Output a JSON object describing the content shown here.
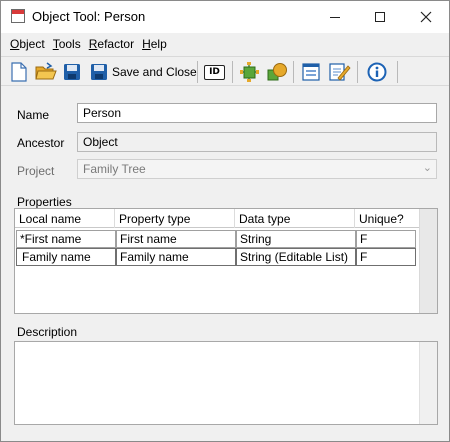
{
  "window": {
    "title": "Object Tool: Person"
  },
  "menu": {
    "items": [
      {
        "accel": "O",
        "rest": "bject"
      },
      {
        "accel": "T",
        "rest": "ools"
      },
      {
        "accel": "R",
        "rest": "efactor"
      },
      {
        "accel": "H",
        "rest": "elp"
      }
    ]
  },
  "toolbar": {
    "save_close_label": "Save and Close",
    "id_label": "ID"
  },
  "form": {
    "name_label": "Name",
    "name_value": "Person",
    "ancestor_label": "Ancestor",
    "ancestor_value": "Object",
    "project_label": "Project",
    "project_value": "Family Tree"
  },
  "properties": {
    "section_label": "Properties",
    "columns": [
      "Local name",
      "Property type",
      "Data type",
      "Unique?"
    ],
    "rows": [
      [
        "*First name",
        "First name",
        "String",
        "F"
      ],
      [
        "Family name",
        "Family name",
        "String (Editable List)",
        "F"
      ]
    ]
  },
  "description": {
    "section_label": "Description",
    "value": ""
  },
  "colors": {
    "title_icon_accent": "#d83a3a",
    "toolbar_blue": "#1f5fa8",
    "info_blue": "#1d63b5",
    "folder_yellow": "#e6a92b",
    "green_cube": "#5aa63a"
  }
}
